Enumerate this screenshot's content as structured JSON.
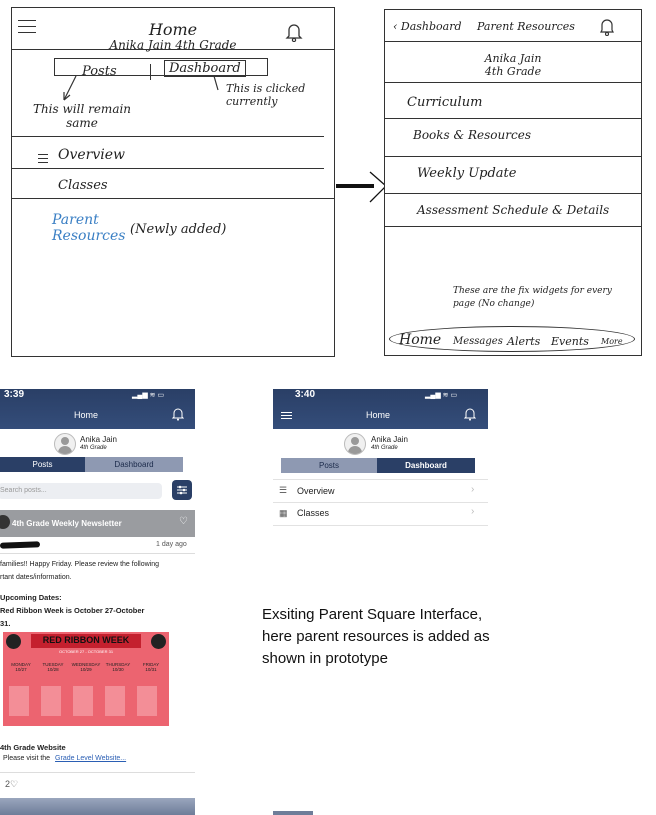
{
  "sketch_left": {
    "title": "Home",
    "subtitle": "Anika Jain 4th Grade",
    "tab_posts": "Posts",
    "tab_dashboard": "Dashboard",
    "note_remain": "This will remain same",
    "note_clicked": "This is clicked currently",
    "item_overview": "Overview",
    "item_classes": "Classes",
    "item_parent_resources": "Parent Resources",
    "note_new": "(Newly added)"
  },
  "sketch_right": {
    "back": "Dashboard",
    "title": "Parent Resources",
    "name": "Anika Jain",
    "grade": "4th Grade",
    "items": [
      {
        "label": "Curriculum"
      },
      {
        "label": "Books & Resources"
      },
      {
        "label": "Weekly Update"
      },
      {
        "label": "Assessment Schedule & Details"
      }
    ],
    "note_widgets": "These are the fix widgets for every page (No change)",
    "bottom_nav": [
      "Home",
      "Messages",
      "Alerts",
      "Events",
      "More"
    ]
  },
  "phone_posts": {
    "time": "3:39",
    "title": "Home",
    "name": "Anika Jain",
    "grade": "4th Grade",
    "tab_posts": "Posts",
    "tab_dashboard": "Dashboard",
    "search_placeholder": "Search posts...",
    "post_title": "4th Grade Weekly Newsletter",
    "post_age": "1 day ago",
    "body_line1": "families!! Happy Friday. Please review the following",
    "body_line2": "rtant dates/information.",
    "upcoming": "Upcoming Dates:",
    "rrw_line1": "Red Ribbon Week is October 27-October",
    "rrw_line2": "31.",
    "banner_title": "RED RIBBON WEEK",
    "banner_dates": "OCTOBER 27 - OCTOBER 31",
    "banner_days": [
      "MONDAY 10/27",
      "TUESDAY 10/28",
      "WEDNESDAY 10/29",
      "THURSDAY 10/30",
      "FRIDAY 10/31"
    ],
    "website_title": "4th Grade Website",
    "website_text": "Please visit the",
    "website_link": "Grade Level Website...",
    "likes": "2"
  },
  "phone_dashboard": {
    "time": "3:40",
    "title": "Home",
    "name": "Anika Jain",
    "grade": "4th Grade",
    "tab_posts": "Posts",
    "tab_dashboard": "Dashboard",
    "items": [
      {
        "label": "Overview"
      },
      {
        "label": "Classes"
      }
    ]
  },
  "caption": "Exsiting Parent Square Interface, here parent resources is added as shown in prototype"
}
